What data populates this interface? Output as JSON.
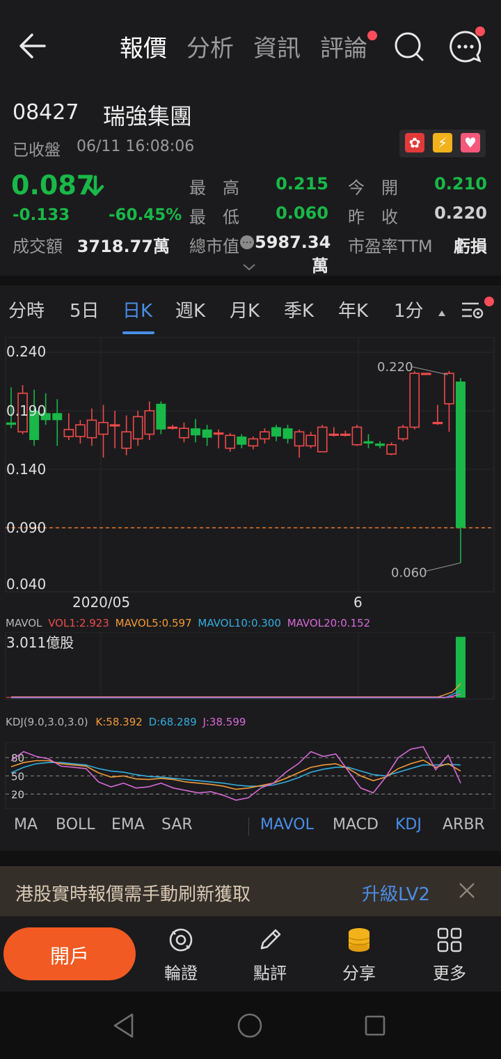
{
  "nav": {
    "tabs": [
      "報價",
      "分析",
      "資訊",
      "評論"
    ],
    "active_tab": "報價"
  },
  "stock": {
    "code": "08427",
    "name": "瑞強集團",
    "status": "已收盤",
    "timestamp": "06/11 16:08:06",
    "price": "0.087",
    "change": "-0.133",
    "change_pct": "-60.45%",
    "turnover_label": "成交額",
    "turnover_value": "3718.77萬",
    "high_label": "最　高",
    "high_value": "0.215",
    "low_label": "最　低",
    "low_value": "0.060",
    "mktcap_label": "總市值",
    "mktcap_value": "5987.34萬",
    "open_label": "今　開",
    "open_value": "0.210",
    "prevclose_label": "昨　收",
    "prevclose_value": "0.220",
    "pe_label": "市盈率TTM",
    "pe_value": "虧損"
  },
  "period_tabs": [
    "分時",
    "5日",
    "日K",
    "週K",
    "月K",
    "季K",
    "年K",
    "1分"
  ],
  "active_period": "日K",
  "chart_data": {
    "type": "candlestick",
    "title": "",
    "y_ticks": [
      "0.240",
      "0.190",
      "0.140",
      "0.090",
      "0.040"
    ],
    "ylim": [
      0.04,
      0.24
    ],
    "x_ticks": [
      "2020/05",
      "6"
    ],
    "reference_line": 0.09,
    "annotations": {
      "high": "0.220",
      "low": "0.060"
    },
    "candles": [
      {
        "o": 0.18,
        "c": 0.178,
        "h": 0.21,
        "l": 0.175
      },
      {
        "o": 0.172,
        "c": 0.205,
        "h": 0.212,
        "l": 0.17
      },
      {
        "o": 0.19,
        "c": 0.165,
        "h": 0.208,
        "l": 0.16
      },
      {
        "o": 0.188,
        "c": 0.182,
        "h": 0.205,
        "l": 0.178
      },
      {
        "o": 0.188,
        "c": 0.182,
        "h": 0.2,
        "l": 0.16
      },
      {
        "o": 0.168,
        "c": 0.174,
        "h": 0.188,
        "l": 0.165
      },
      {
        "o": 0.168,
        "c": 0.178,
        "h": 0.182,
        "l": 0.162
      },
      {
        "o": 0.167,
        "c": 0.182,
        "h": 0.192,
        "l": 0.16
      },
      {
        "o": 0.17,
        "c": 0.18,
        "h": 0.195,
        "l": 0.15
      },
      {
        "o": 0.178,
        "c": 0.178,
        "h": 0.19,
        "l": 0.158
      },
      {
        "o": 0.158,
        "c": 0.172,
        "h": 0.186,
        "l": 0.152
      },
      {
        "o": 0.166,
        "c": 0.185,
        "h": 0.19,
        "l": 0.16
      },
      {
        "o": 0.17,
        "c": 0.19,
        "h": 0.198,
        "l": 0.165
      },
      {
        "o": 0.196,
        "c": 0.174,
        "h": 0.198,
        "l": 0.17
      },
      {
        "o": 0.176,
        "c": 0.176,
        "h": 0.178,
        "l": 0.174
      },
      {
        "o": 0.167,
        "c": 0.175,
        "h": 0.18,
        "l": 0.163
      },
      {
        "o": 0.175,
        "c": 0.169,
        "h": 0.183,
        "l": 0.163
      },
      {
        "o": 0.174,
        "c": 0.167,
        "h": 0.178,
        "l": 0.16
      },
      {
        "o": 0.171,
        "c": 0.171,
        "h": 0.174,
        "l": 0.158
      },
      {
        "o": 0.158,
        "c": 0.169,
        "h": 0.171,
        "l": 0.155
      },
      {
        "o": 0.168,
        "c": 0.161,
        "h": 0.17,
        "l": 0.158
      },
      {
        "o": 0.16,
        "c": 0.166,
        "h": 0.168,
        "l": 0.157
      },
      {
        "o": 0.166,
        "c": 0.172,
        "h": 0.175,
        "l": 0.162
      },
      {
        "o": 0.176,
        "c": 0.168,
        "h": 0.178,
        "l": 0.164
      },
      {
        "o": 0.175,
        "c": 0.166,
        "h": 0.178,
        "l": 0.162
      },
      {
        "o": 0.16,
        "c": 0.172,
        "h": 0.174,
        "l": 0.15
      },
      {
        "o": 0.16,
        "c": 0.169,
        "h": 0.172,
        "l": 0.158
      },
      {
        "o": 0.155,
        "c": 0.176,
        "h": 0.178,
        "l": 0.155
      },
      {
        "o": 0.17,
        "c": 0.17,
        "h": 0.176,
        "l": 0.168
      },
      {
        "o": 0.17,
        "c": 0.17,
        "h": 0.173,
        "l": 0.168
      },
      {
        "o": 0.161,
        "c": 0.176,
        "h": 0.178,
        "l": 0.16
      },
      {
        "o": 0.164,
        "c": 0.162,
        "h": 0.17,
        "l": 0.158
      },
      {
        "o": 0.162,
        "c": 0.16,
        "h": 0.164,
        "l": 0.158
      },
      {
        "o": 0.153,
        "c": 0.161,
        "h": 0.163,
        "l": 0.152
      },
      {
        "o": 0.166,
        "c": 0.176,
        "h": 0.178,
        "l": 0.164
      },
      {
        "o": 0.176,
        "c": 0.222,
        "h": 0.224,
        "l": 0.174
      },
      {
        "o": 0.222,
        "c": 0.222,
        "h": 0.222,
        "l": 0.221
      },
      {
        "o": 0.18,
        "c": 0.18,
        "h": 0.195,
        "l": 0.178
      },
      {
        "o": 0.196,
        "c": 0.222,
        "h": 0.224,
        "l": 0.172
      },
      {
        "o": 0.215,
        "c": 0.09,
        "h": 0.218,
        "l": 0.06
      }
    ]
  },
  "volume": {
    "legend_title": "MAVOL",
    "vol": "VOL1:2.923",
    "ma5": "MAVOL5:0.597",
    "ma10": "MAVOL10:0.300",
    "ma20": "MAVOL20:0.152",
    "max_label": "3.011億股",
    "values": [
      0.002,
      0.003,
      0.002,
      0.002,
      0.002,
      0.001,
      0.002,
      0.002,
      0.002,
      0.001,
      0.002,
      0.002,
      0.002,
      0.003,
      0.001,
      0.002,
      0.002,
      0.001,
      0.001,
      0.002,
      0.002,
      0.001,
      0.001,
      0.002,
      0.002,
      0.001,
      0.002,
      0.001,
      0.001,
      0.001,
      0.002,
      0.001,
      0.001,
      0.001,
      0.002,
      0.004,
      0.002,
      0.003,
      0.02,
      2.923
    ]
  },
  "kdj": {
    "legend_title": "KDJ(9.0,3.0,3.0)",
    "k": "K:58.392",
    "d": "D:68.289",
    "j": "J:38.599",
    "levels": [
      "80",
      "50",
      "20"
    ],
    "k_values": [
      65,
      72,
      75,
      75,
      70,
      68,
      66,
      55,
      48,
      50,
      45,
      44,
      46,
      44,
      40,
      38,
      36,
      33,
      28,
      30,
      34,
      38,
      46,
      55,
      64,
      68,
      70,
      62,
      50,
      42,
      48,
      62,
      70,
      76,
      64,
      70,
      58
    ],
    "d_values": [
      55,
      64,
      70,
      72,
      72,
      70,
      68,
      62,
      58,
      56,
      52,
      49,
      48,
      46,
      44,
      42,
      40,
      38,
      35,
      33,
      33,
      35,
      40,
      47,
      56,
      61,
      64,
      64,
      58,
      52,
      50,
      56,
      62,
      68,
      68,
      69,
      68
    ],
    "j_values": [
      75,
      90,
      82,
      78,
      66,
      64,
      62,
      40,
      32,
      38,
      30,
      32,
      38,
      30,
      26,
      22,
      24,
      18,
      10,
      14,
      30,
      38,
      56,
      70,
      90,
      82,
      86,
      58,
      30,
      22,
      48,
      80,
      94,
      98,
      60,
      84,
      38
    ]
  },
  "indicator_tabs_left": [
    "MA",
    "BOLL",
    "EMA",
    "SAR"
  ],
  "indicator_tabs_right": [
    "MAVOL",
    "MACD",
    "KDJ",
    "ARBR"
  ],
  "banner": {
    "text": "港股實時報價需手動刷新獲取",
    "action": "升級LV2"
  },
  "bottom": {
    "open_account": "開戶",
    "items": [
      "輪證",
      "點評",
      "分享",
      "更多"
    ]
  },
  "colors": {
    "up": "#f04a4a",
    "down": "#19b848",
    "accent": "#4a8ee8",
    "orange_button": "#f15a22"
  }
}
